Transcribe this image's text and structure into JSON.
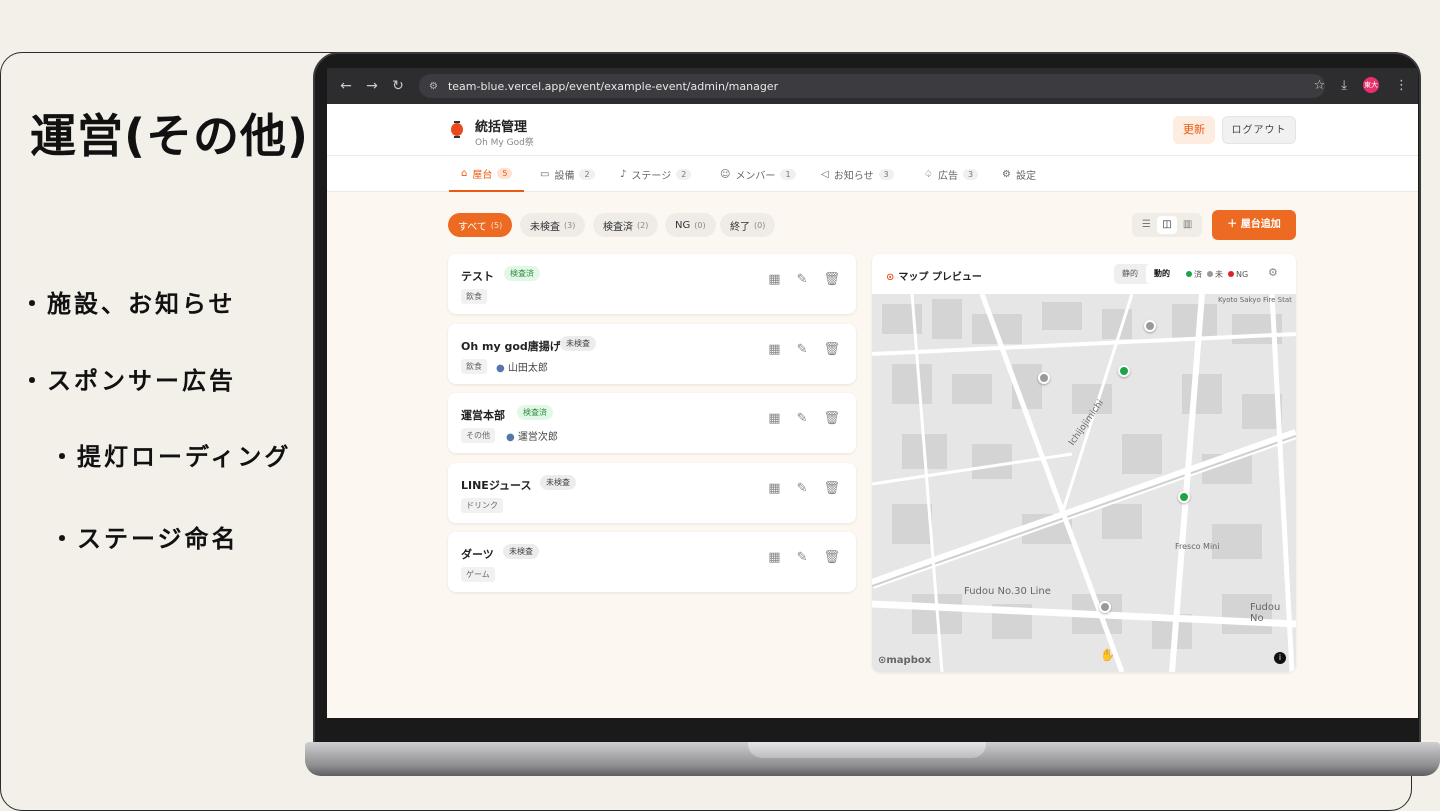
{
  "slide": {
    "title": "運営(その他)",
    "bullets": [
      "・施設、お知らせ",
      "・スポンサー広告",
      "・提灯ローディング",
      "・ステージ命名"
    ]
  },
  "browser": {
    "url": "team-blue.vercel.app/event/example-event/admin/manager",
    "avatar_text": "東大"
  },
  "header": {
    "title": "統括管理",
    "subtitle": "Oh My God祭",
    "refresh_label": "更新",
    "logout_label": "ログアウト"
  },
  "tabs": [
    {
      "label": "屋台",
      "count": "5",
      "active": true
    },
    {
      "label": "設備",
      "count": "2"
    },
    {
      "label": "ステージ",
      "count": "2"
    },
    {
      "label": "メンバー",
      "count": "1"
    },
    {
      "label": "お知らせ",
      "count": "3"
    },
    {
      "label": "広告",
      "count": "3"
    },
    {
      "label": "設定",
      "count": ""
    }
  ],
  "filters": [
    {
      "label": "すべて",
      "count": "(5)",
      "active": true
    },
    {
      "label": "未検査",
      "count": "(3)"
    },
    {
      "label": "検査済",
      "count": "(2)"
    },
    {
      "label": "NG",
      "count": "(0)"
    },
    {
      "label": "終了",
      "count": "(0)"
    }
  ],
  "add_button_label": "＋ 屋台追加",
  "stalls": [
    {
      "name": "テスト",
      "status": "検査済",
      "category": "飲食",
      "owner": ""
    },
    {
      "name": "Oh my god唐揚げ",
      "status": "未検査",
      "category": "飲食",
      "owner": "山田太郎"
    },
    {
      "name": "運営本部",
      "status": "検査済",
      "category": "その他",
      "owner": "運営次郎"
    },
    {
      "name": "LINEジュース",
      "status": "未検査",
      "category": "ドリンク",
      "owner": ""
    },
    {
      "name": "ダーツ",
      "status": "未検査",
      "category": "ゲーム",
      "owner": ""
    }
  ],
  "map": {
    "title": "マップ プレビュー",
    "mode_static": "静的",
    "mode_dynamic": "動的",
    "legend": [
      {
        "label": "済",
        "color": "#1fa34a"
      },
      {
        "label": "未",
        "color": "#999999"
      },
      {
        "label": "NG",
        "color": "#e02424"
      }
    ],
    "labels": [
      "Kyoto Sakyo Fire Stat",
      "Ichijojimichi",
      "Fresco Mini",
      "Fudou No.30 Line",
      "Fudou No"
    ],
    "attribution": "mapbox"
  }
}
